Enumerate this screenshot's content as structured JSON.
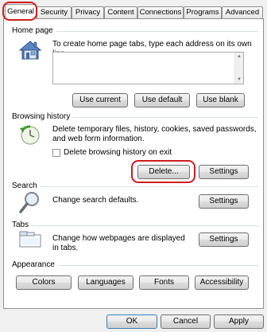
{
  "tabs": [
    "General",
    "Security",
    "Privacy",
    "Content",
    "Connections",
    "Programs",
    "Advanced"
  ],
  "home_page": {
    "title": "Home page",
    "description": "To create home page tabs, type each address on its own line.",
    "address_value": "",
    "use_current": "Use current",
    "use_default": "Use default",
    "use_blank": "Use blank"
  },
  "browsing_history": {
    "title": "Browsing history",
    "description": "Delete temporary files, history, cookies, saved passwords, and web form information.",
    "checkbox_label": "Delete browsing history on exit",
    "checkbox_checked": false,
    "delete": "Delete...",
    "settings": "Settings"
  },
  "search": {
    "title": "Search",
    "description": "Change search defaults.",
    "settings": "Settings"
  },
  "tabs_section": {
    "title": "Tabs",
    "description": "Change how webpages are displayed in tabs.",
    "settings": "Settings"
  },
  "appearance": {
    "title": "Appearance",
    "colors": "Colors",
    "languages": "Languages",
    "fonts": "Fonts",
    "accessibility": "Accessibility"
  },
  "footer": {
    "ok": "OK",
    "cancel": "Cancel",
    "apply": "Apply"
  },
  "colors": {
    "highlight": "#d01d1d",
    "window_bg": "#f0f0f0"
  }
}
